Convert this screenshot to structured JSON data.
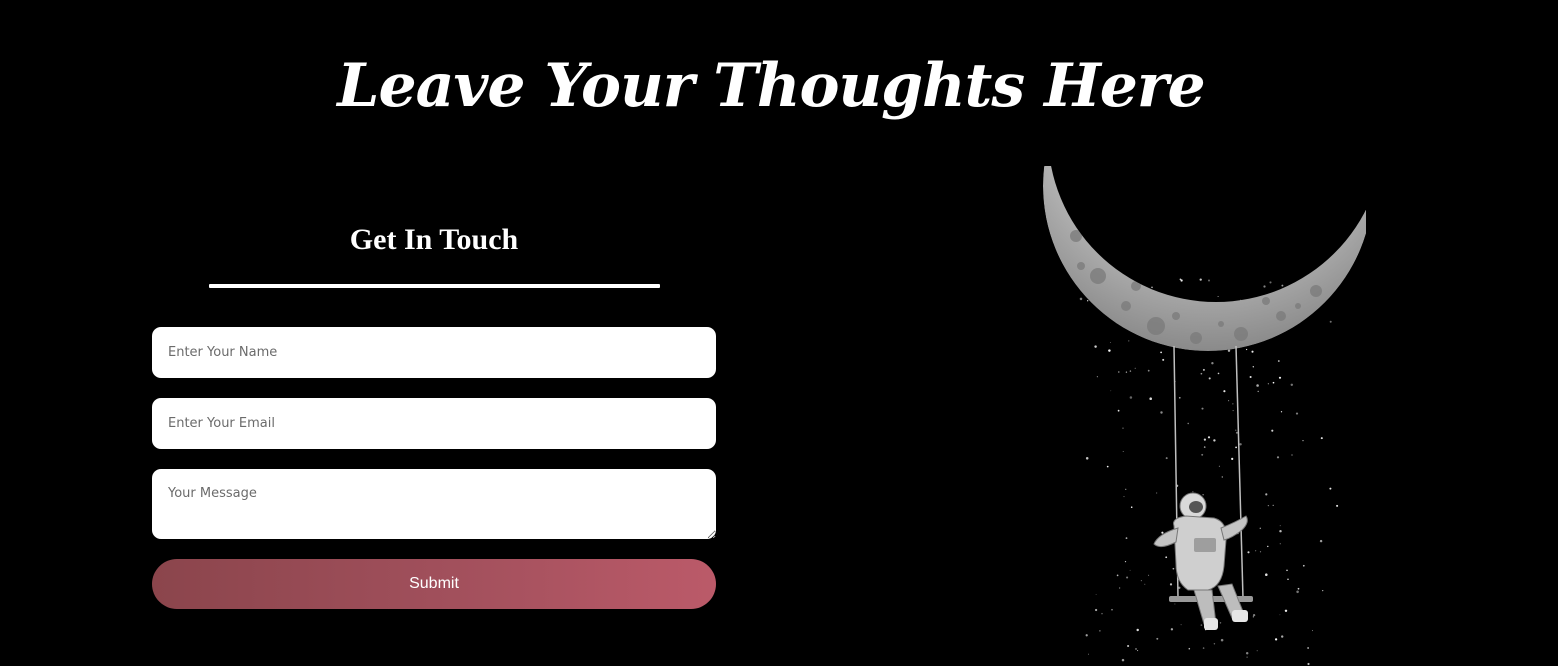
{
  "page": {
    "title": "Leave Your Thoughts Here"
  },
  "contact_form": {
    "heading": "Get In Touch",
    "name_placeholder": "Enter Your Name",
    "email_placeholder": "Enter Your Email",
    "message_placeholder": "Your Message",
    "submit_label": "Submit"
  },
  "illustration": {
    "icon": "astronaut-on-moon-swing-illustration"
  },
  "colors": {
    "background": "#000000",
    "text": "#ffffff",
    "button_gradient_start": "#8b454c",
    "button_gradient_end": "#bb5a69",
    "field_background": "#ffffff"
  }
}
